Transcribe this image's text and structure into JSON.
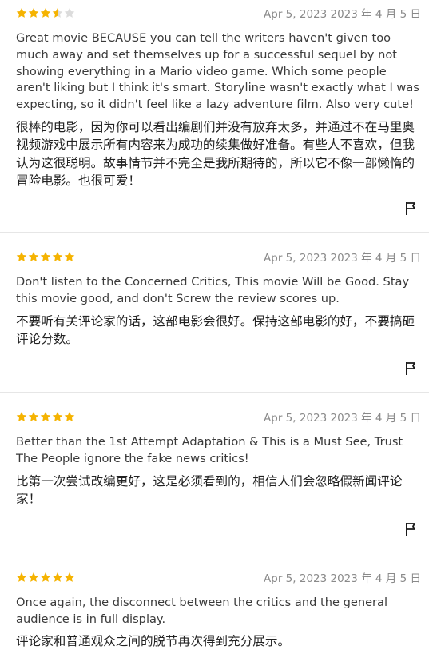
{
  "colors": {
    "star_filled": "#f5b301",
    "star_empty": "#dcdcdc",
    "divider": "#e6e6e6",
    "date_text": "#8a8a8a"
  },
  "reviews": [
    {
      "rating": 3.5,
      "date": "Apr 5, 2023 2023 年 4 月 5 日",
      "text_en": "Great movie BECAUSE you can tell the writers haven't given too much away and set themselves up for a successful sequel by not showing everything in a Mario video game. Which some people aren't liking but I think it's smart. Storyline wasn't exactly what I was expecting, so it didn't feel like a lazy adventure film. Also very cute!",
      "text_zh": "很棒的电影，因为你可以看出编剧们并没有放弃太多，并通过不在马里奥视频游戏中展示所有内容来为成功的续集做好准备。有些人不喜欢，但我认为这很聪明。故事情节并不完全是我所期待的，所以它不像一部懒惰的冒险电影。也很可爱！",
      "flag_icon": "flag-icon"
    },
    {
      "rating": 5,
      "date": "Apr 5, 2023 2023 年 4 月 5 日",
      "text_en": "Don't listen to the Concerned Critics, This movie Will be Good. Stay this movie good, and don't Screw the review scores up.",
      "text_zh": "不要听有关评论家的话，这部电影会很好。保持这部电影的好，不要搞砸评论分数。",
      "flag_icon": "flag-icon"
    },
    {
      "rating": 5,
      "date": "Apr 5, 2023 2023 年 4 月 5 日",
      "text_en": "Better than the 1st Attempt Adaptation & This is a Must See, Trust The People ignore the fake news critics!",
      "text_zh": "比第一次尝试改编更好，这是必须看到的，相信人们会忽略假新闻评论家！",
      "flag_icon": "flag-icon"
    },
    {
      "rating": 5,
      "date": "Apr 5, 2023 2023 年 4 月 5 日",
      "text_en": "Once again, the disconnect between the critics and the general audience is in full display.",
      "text_zh": "评论家和普通观众之间的脱节再次得到充分展示。",
      "flag_icon": "flag-icon"
    }
  ]
}
